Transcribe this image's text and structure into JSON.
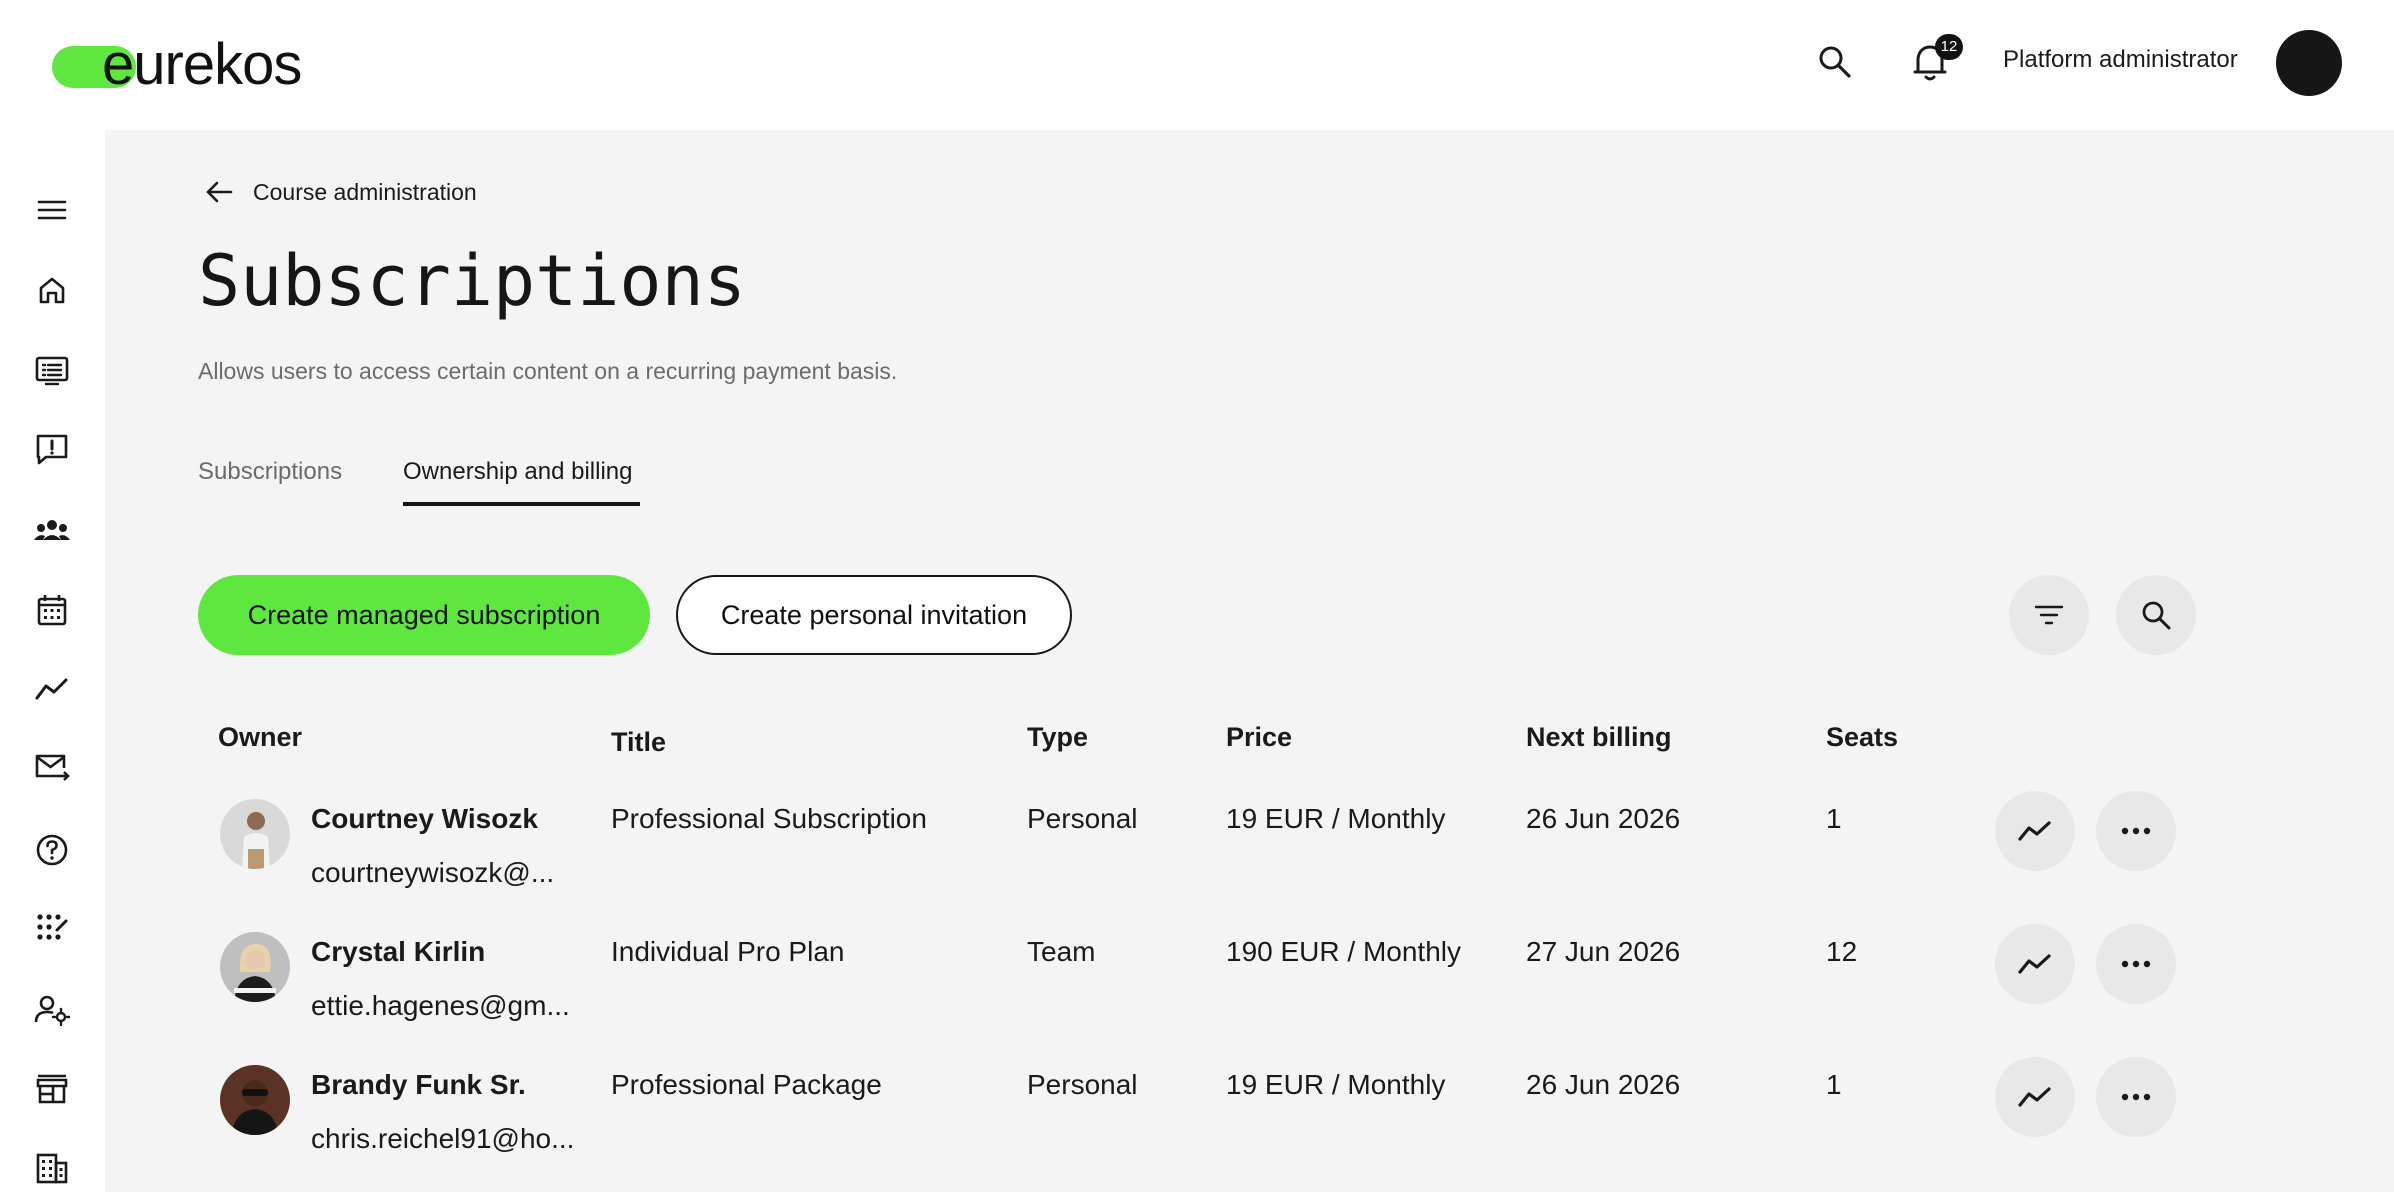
{
  "app": {
    "logo_text": "eurekos"
  },
  "header": {
    "notification_count": "12",
    "user_name": "Platform administrator"
  },
  "sidebar": {
    "icons": [
      "menu-icon",
      "home-icon",
      "courses-icon",
      "feedback-icon",
      "users-icon",
      "calendar-icon",
      "analytics-icon",
      "mail-forward-icon",
      "help-icon",
      "apps-icon",
      "user-settings-icon",
      "store-icon",
      "organization-icon"
    ]
  },
  "breadcrumb": {
    "label": "Course administration"
  },
  "page": {
    "title": "Subscriptions",
    "subtitle": "Allows users to access certain content on a recurring payment basis."
  },
  "tabs": [
    {
      "label": "Subscriptions",
      "active": false
    },
    {
      "label": "Ownership and billing",
      "active": true
    }
  ],
  "actions": {
    "create_managed": "Create managed subscription",
    "create_invitation": "Create personal invitation"
  },
  "table": {
    "headers": {
      "owner": "Owner",
      "title": "Title",
      "type": "Type",
      "price": "Price",
      "next_billing": "Next billing",
      "seats": "Seats"
    },
    "rows": [
      {
        "name": "Courtney Wisozk",
        "email": "courtneywisozk@...",
        "title": "Professional Subscription",
        "type": "Personal",
        "price": "19 EUR / Monthly",
        "next_billing": "26 Jun 2026",
        "seats": "1"
      },
      {
        "name": "Crystal Kirlin",
        "email": "ettie.hagenes@gm...",
        "title": "Individual Pro Plan",
        "type": "Team",
        "price": "190 EUR / Monthly",
        "next_billing": "27 Jun 2026",
        "seats": "12"
      },
      {
        "name": "Brandy Funk Sr.",
        "email": "chris.reichel91@ho...",
        "title": "Professional Package",
        "type": "Personal",
        "price": "19 EUR / Monthly",
        "next_billing": "26 Jun 2026",
        "seats": "1"
      }
    ]
  },
  "colors": {
    "accent": "#5ee83f",
    "background": "#f4f4f4",
    "dark": "#161616"
  }
}
